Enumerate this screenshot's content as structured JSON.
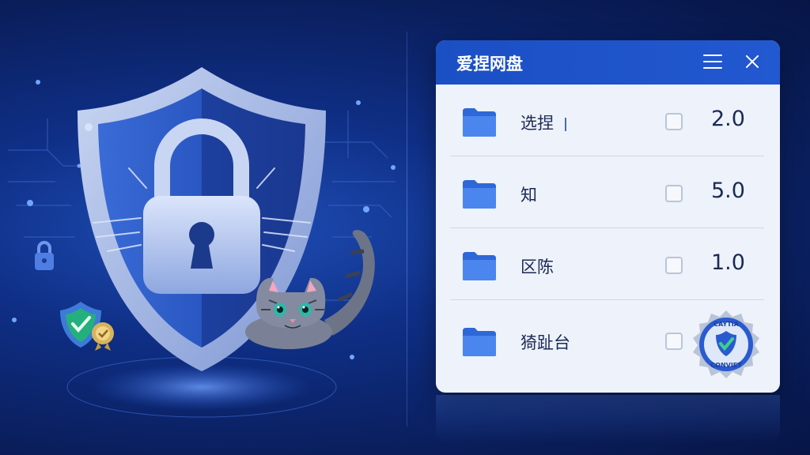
{
  "window": {
    "title": "爱捏网盘",
    "menu_icon": "hamburger-menu-icon",
    "close_icon": "close-icon"
  },
  "files": [
    {
      "name": "选捏",
      "value": "2.0",
      "checked": false,
      "icon": "folder-icon"
    },
    {
      "name": "知",
      "value": "5.0",
      "checked": false,
      "icon": "folder-icon"
    },
    {
      "name": "区陈",
      "value": "1.0",
      "checked": false,
      "icon": "folder-icon"
    },
    {
      "name": "猗趾台",
      "value": "",
      "checked": false,
      "icon": "folder-icon"
    }
  ],
  "badge": {
    "text_top": "CAYTIA",
    "text_bottom": "CONVIET"
  },
  "colors": {
    "accent": "#1b4fc4",
    "background": "#0a1f5e",
    "folder": "#3f7be8"
  }
}
